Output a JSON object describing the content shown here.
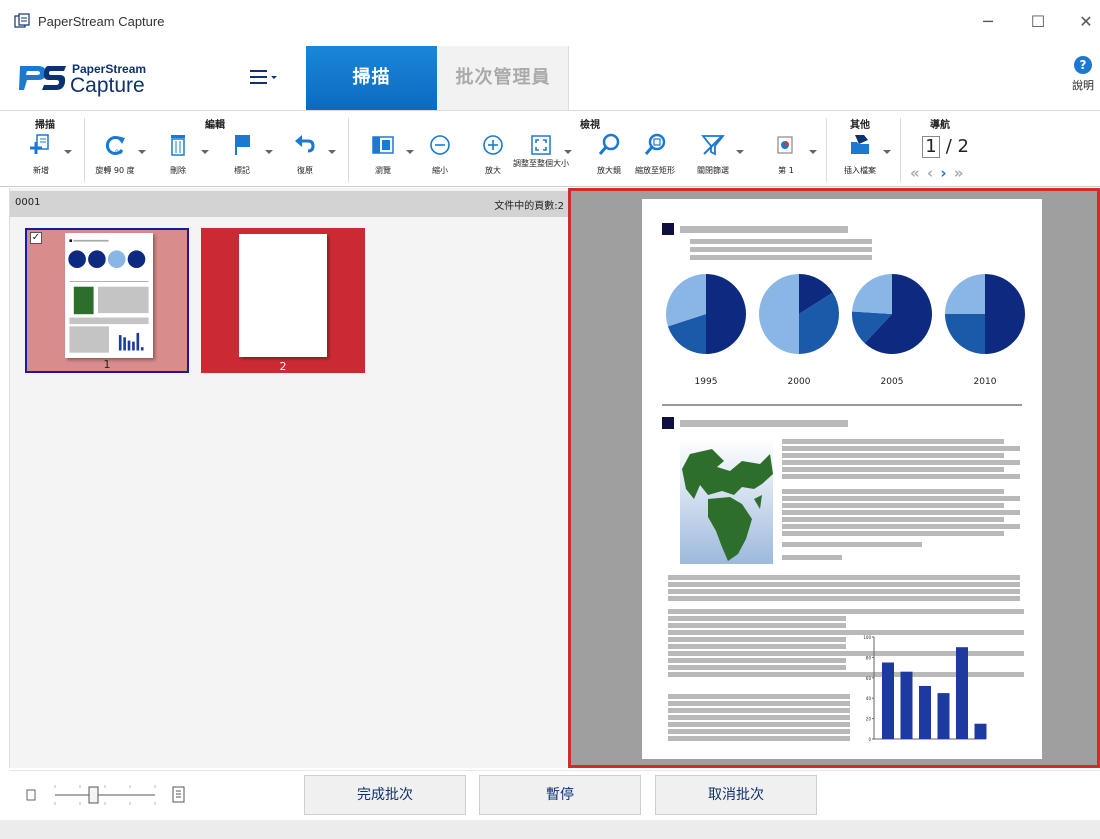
{
  "window": {
    "title": "PaperStream Capture",
    "minimize": "─",
    "maximize": "☐",
    "close": "✕"
  },
  "header": {
    "logo_top": "PaperStream",
    "logo_bottom": "Capture",
    "tabs": [
      {
        "label": "掃描"
      },
      {
        "label": "批次管理員"
      }
    ],
    "help_label": "說明",
    "help_symbol": "?"
  },
  "ribbon": {
    "groups": {
      "scan": "掃描",
      "edit": "編輯",
      "view": "檢視",
      "other": "其他",
      "navigate": "導航"
    },
    "buttons": {
      "new": "新增",
      "rotate": "旋轉 90 度",
      "delete": "刪除",
      "mark": "標記",
      "undo": "復原",
      "browse": "瀏覽",
      "zoom_out": "縮小",
      "zoom_in": "放大",
      "fit": "調整至整個大小",
      "magnifier": "放大鏡",
      "zoom_rect": "縮放至矩形",
      "filter": "關閉篩選",
      "first": "第 1",
      "insert": "插入檔案"
    },
    "nav": {
      "current": "1",
      "total": "/ 2"
    }
  },
  "left_panel": {
    "batch_id": "0001",
    "page_count_label": "文件中的頁數:2",
    "thumbnails": [
      {
        "number": "1",
        "checked": true
      },
      {
        "number": "2",
        "checked": false
      }
    ]
  },
  "document": {
    "chart_data": [
      {
        "type": "pie",
        "categories": [
          "1995",
          "2000",
          "2005",
          "2010"
        ]
      },
      {
        "type": "bar",
        "ylim": [
          0,
          100
        ],
        "ytick_labels": [
          "100",
          "80",
          "60",
          "40",
          "20",
          "0"
        ],
        "values": [
          75,
          66,
          52,
          45,
          90,
          15
        ]
      }
    ]
  },
  "bottom": {
    "buttons": {
      "finish": "完成批次",
      "pause": "暫停",
      "cancel": "取消批次"
    }
  },
  "colors": {
    "accent": "#0b6bc0",
    "selected_border": "#cf2d2d",
    "thumb_selected": "#d88c8c",
    "thumb_red": "#cc2a33"
  }
}
